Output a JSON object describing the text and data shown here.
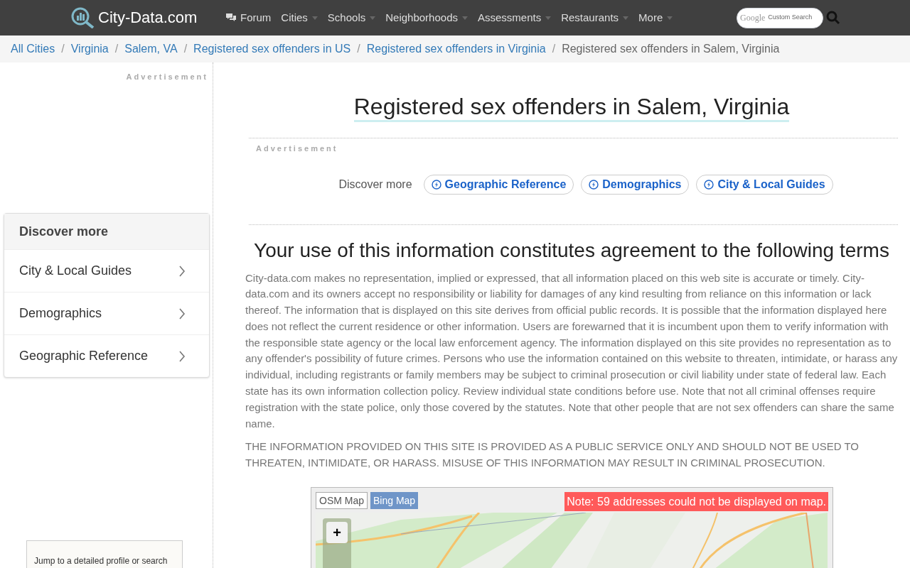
{
  "header": {
    "logo": "City-Data.com",
    "nav": [
      {
        "label": "Forum",
        "kind": "forum"
      },
      {
        "label": "Cities",
        "kind": "menu"
      },
      {
        "label": "Schools",
        "kind": "menu"
      },
      {
        "label": "Neighborhoods",
        "kind": "menu"
      },
      {
        "label": "Assessments",
        "kind": "menu"
      },
      {
        "label": "Restaurants",
        "kind": "menu"
      },
      {
        "label": "More",
        "kind": "menu"
      }
    ],
    "search": {
      "brand": "Google",
      "placeholder": "Custom Search"
    }
  },
  "breadcrumb_separator": "/",
  "breadcrumb": [
    {
      "label": "All Cities",
      "kind": "link"
    },
    {
      "label": "Virginia",
      "kind": "link"
    },
    {
      "label": "Salem, VA",
      "kind": "link"
    },
    {
      "label": "Registered sex offenders in US",
      "kind": "link"
    },
    {
      "label": "Registered sex offenders in Virginia",
      "kind": "link"
    },
    {
      "label": "Registered sex offenders in Salem, Virginia",
      "kind": "current"
    }
  ],
  "sidebar": {
    "ad_label": "Advertisement",
    "discover": {
      "title": "Discover more",
      "items": [
        "City & Local Guides",
        "Demographics",
        "Geographic Reference"
      ]
    },
    "jump_box": "Jump to a detailed profile or search"
  },
  "main": {
    "title": "Registered sex offenders in Salem, Virginia",
    "ad_label": "Advertisement",
    "discover": {
      "label": "Discover more",
      "chips": [
        "Geographic Reference",
        "Demographics",
        "City & Local Guides"
      ]
    },
    "terms_title": "Your use of this information constitutes agreement to the following terms",
    "paragraphs": [
      "City-data.com makes no representation, implied or expressed, that all information placed on this web site is accurate or timely. City-data.com and its owners accept no responsibility or liability for damages of any kind resulting from reliance on this information or lack thereof. The information that is displayed on this site derives from official public records. It is possible that the information displayed here does not reflect the current residence or other information. Users are forewarned that it is incumbent upon them to verify information with the responsible state agency or the local law enforcement agency. The information displayed on this site provides no representation as to any offender's possibility of future crimes. Persons who use the information contained on this website to threaten, intimidate, or harass any individual, including registrants or family members may be subject to criminal prosecution or civil liability under state of federal law. Each state has its own information collection policy. Review individual state conditions before use. Note that not all criminal offenses require registration with the state police, only those covered by the statutes. Note that other people that are not sex offenders can share the same name.",
      "THE INFORMATION PROVIDED ON THIS SITE IS PROVIDED AS A PUBLIC SERVICE ONLY AND SHOULD NOT BE USED TO THREATEN, INTIMIDATE, OR HARASS. MISUSE OF THIS INFORMATION MAY RESULT IN CRIMINAL PROSECUTION."
    ],
    "map": {
      "tabs": [
        {
          "label": "OSM Map",
          "selected": true
        },
        {
          "label": "Bing Map",
          "selected": false
        }
      ],
      "note": "Note: 59 addresses could not be displayed on map.",
      "zoom_in": "+"
    }
  }
}
